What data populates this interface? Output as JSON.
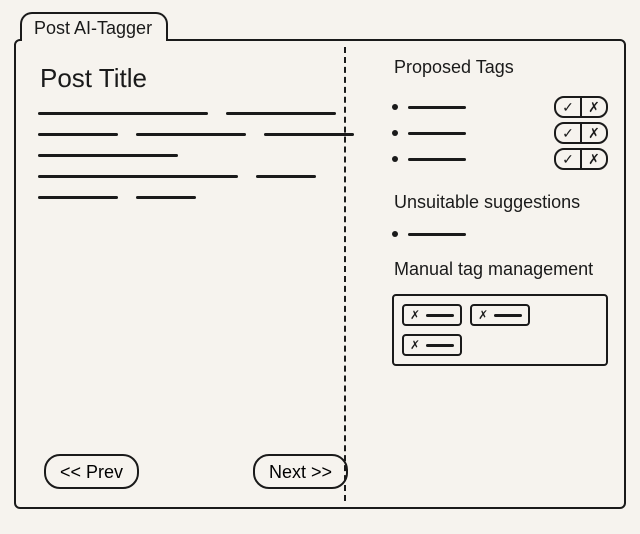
{
  "tab_label": "Post AI-Tagger",
  "left": {
    "post_title": "Post Title",
    "body_rows": [
      [
        170,
        110
      ],
      [
        80,
        110,
        90
      ],
      [
        140
      ],
      [
        200,
        60
      ],
      [
        80,
        60
      ]
    ],
    "prev_label": "<< Prev",
    "next_label": "Next >>"
  },
  "right": {
    "proposed_heading": "Proposed Tags",
    "proposed_tags": [
      {
        "accept": "✓",
        "reject": "✗"
      },
      {
        "accept": "✓",
        "reject": "✗"
      },
      {
        "accept": "✓",
        "reject": "✗"
      }
    ],
    "unsuitable_heading": "Unsuitable suggestions",
    "unsuitable_tags": [
      {}
    ],
    "manual_heading": "Manual tag management",
    "manual_chips": [
      {
        "remove": "✗"
      },
      {
        "remove": "✗"
      },
      {
        "remove": "✗"
      }
    ]
  }
}
